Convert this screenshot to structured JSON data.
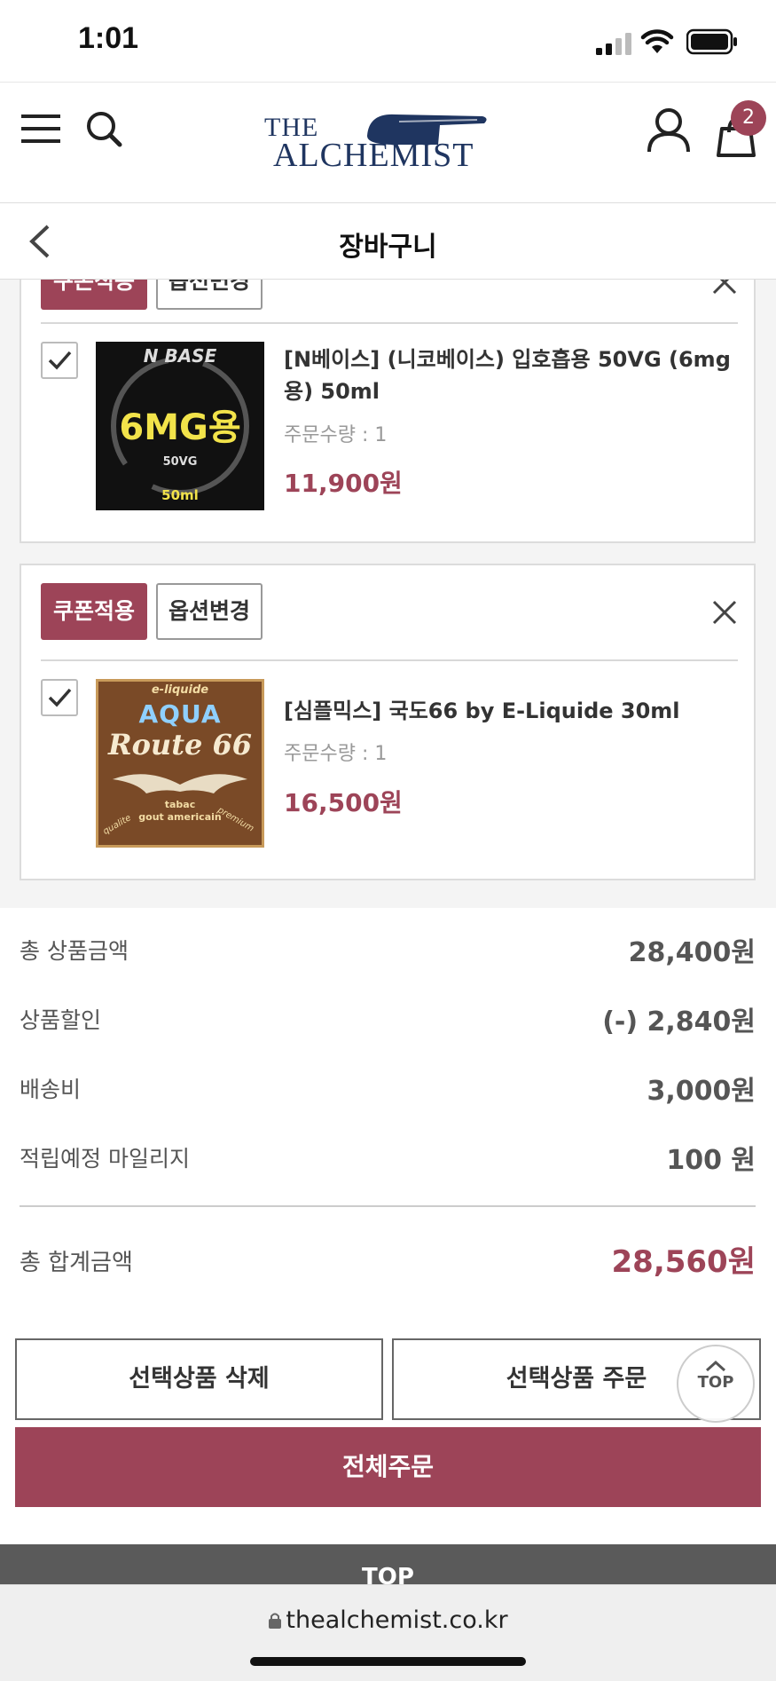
{
  "status_bar": {
    "time": "1:01"
  },
  "header": {
    "logo_line1": "THE",
    "logo_line2": "ALCHEMIST",
    "cart_count": "2"
  },
  "subheader": {
    "title": "장바구니"
  },
  "items": [
    {
      "coupon_label": "쿠폰적용",
      "option_label": "옵션변경",
      "name": "[N베이스] (니코베이스) 입호흡용 50VG (6mg용) 50ml",
      "name_line1": "[N베이스] (니코베이스) 입호흡용 50VG (6mg",
      "name_line2": "용) 50ml",
      "qty": "주문수량 : 1",
      "price": "11,900원",
      "thumb": {
        "top": "N BASE",
        "main": "6MG용",
        "vg": "50VG",
        "vol": "50ml"
      }
    },
    {
      "coupon_label": "쿠폰적용",
      "option_label": "옵션변경",
      "name": "[심플믹스] 국도66 by E-Liquide 30ml",
      "qty": "주문수량 : 1",
      "price": "16,500원",
      "thumb": {
        "top": "e-liquide",
        "brand": "AQUA",
        "main": "Route 66",
        "sub1": "tabac",
        "sub2": "gout americain",
        "left": "qualite",
        "right": "premium"
      }
    }
  ],
  "summary": {
    "rows": [
      {
        "label": "총 상품금액",
        "value": "28,400원"
      },
      {
        "label": "상품할인",
        "value": "(-) 2,840원"
      },
      {
        "label": "배송비",
        "value": "3,000원"
      },
      {
        "label": "적립예정 마일리지",
        "value": "100 원"
      }
    ],
    "total_label": "총 합계금액",
    "total_value": "28,560원"
  },
  "actions": {
    "delete_selected": "선택상품 삭제",
    "order_selected": "선택상품 주문",
    "order_all": "전체주문",
    "top": "TOP"
  },
  "footer": {
    "top_label": "TOP"
  },
  "browser": {
    "url": "thealchemist.co.kr"
  },
  "colors": {
    "accent": "#9d4458"
  }
}
